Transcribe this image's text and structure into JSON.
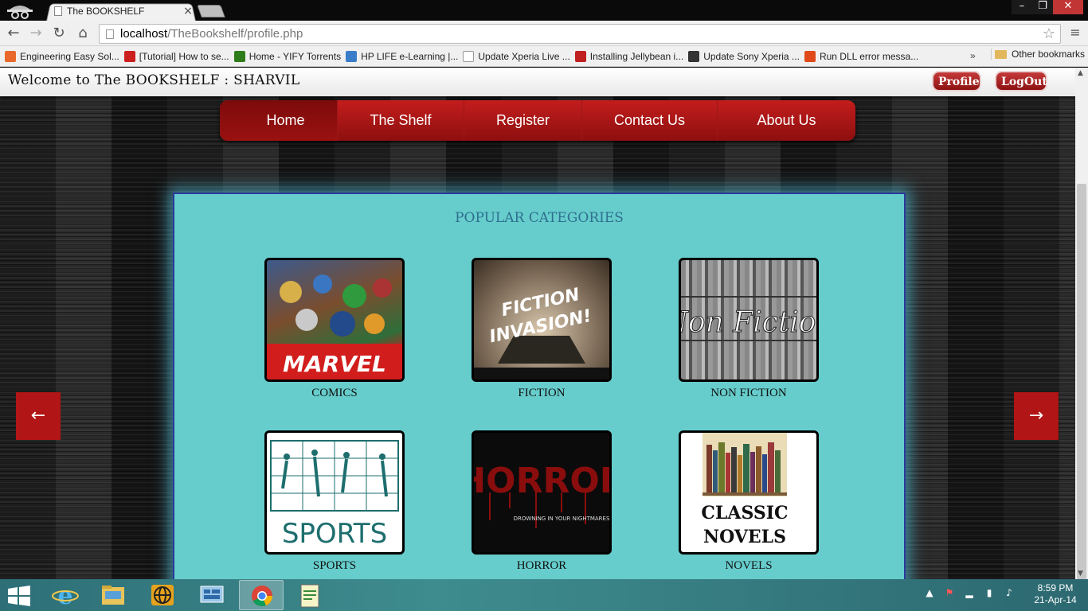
{
  "browser": {
    "tab_title": "The BOOKSHELF",
    "url_host": "localhost",
    "url_path": "/TheBookshelf/profile.php",
    "bookmarks": [
      {
        "label": "Engineering Easy Sol...",
        "color": "#e8692b"
      },
      {
        "label": "[Tutorial] How to se...",
        "color": "#cc1f1f"
      },
      {
        "label": "Home - YIFY Torrents",
        "color": "#2f7d1a"
      },
      {
        "label": "HP LIFE e-Learning |...",
        "color": "#3a7dc8"
      },
      {
        "label": "Update Xperia Live ...",
        "color": "#ffffff"
      },
      {
        "label": "Installing Jellybean i...",
        "color": "#c02020"
      },
      {
        "label": "Update Sony Xperia ...",
        "color": "#333333"
      },
      {
        "label": "Run DLL error messa...",
        "color": "#e04a1a"
      }
    ],
    "bookmarks_more": "»",
    "other_bookmarks": "Other bookmarks"
  },
  "site": {
    "welcome": "Welcome to The BOOKSHELF : SHARVIL",
    "profile_label": "Profile",
    "logout_label": "LogOut",
    "nav": {
      "home": "Home",
      "shelf": "The Shelf",
      "register": "Register",
      "contact": "Contact Us",
      "about": "About Us"
    },
    "panel_title": "POPULAR CATEGORIES",
    "categories": {
      "comics": "COMICS",
      "fiction": "FICTION",
      "nonfiction": "NON FICTION",
      "sports": "SPORTS",
      "horror": "HORROR",
      "novels": "NOVELS"
    },
    "image_text": {
      "marvel": "MARVEL",
      "fiction_line1": "FICTION",
      "fiction_line2": "INVASION!",
      "nonfiction": "Non Fiction",
      "sports": "SPORTS",
      "horror": "HORROR",
      "horror_sub": "DROWNING IN YOUR NIGHTMARES",
      "novels_line1": "CLASSIC",
      "novels_line2": "NOVELS"
    },
    "arrow_left": "←",
    "arrow_right": "→"
  },
  "taskbar": {
    "time": "8:59 PM",
    "date": "21-Apr-14"
  },
  "colors": {
    "accent_red": "#b21515",
    "panel_teal": "#66cdcc"
  }
}
